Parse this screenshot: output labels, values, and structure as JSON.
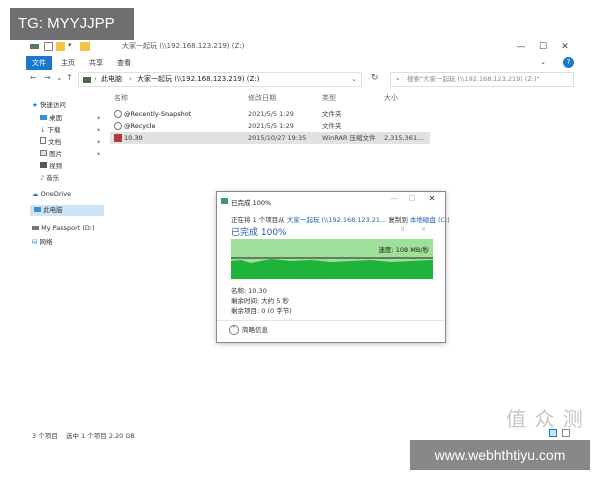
{
  "watermarks": {
    "top": "TG: MYYJJPP",
    "bottom": "www.webhthtiyu.com",
    "logo": "值 众 测"
  },
  "window": {
    "title": "大家一起玩 (\\\\192.168.123.219) (Z:)",
    "controls": {
      "minimize": "—",
      "maximize": "☐",
      "close": "✕"
    },
    "accent_color": "#1979ca"
  },
  "ribbon": {
    "tabs": [
      "文件",
      "主页",
      "共享",
      "查看"
    ],
    "active_tab": "文件"
  },
  "address": {
    "back": "←",
    "forward": "→",
    "recent": "⌄",
    "up": "↑",
    "root": "此电脑",
    "current": "大家一起玩 (\\\\192.168.123.219) (Z:)",
    "refresh": "↻",
    "search_placeholder": "搜索\"大家一起玩 (\\\\192.168.123.219) (Z:)\""
  },
  "sidebar": {
    "quick_access": "快速访问",
    "items": [
      "桌面",
      "下载",
      "文档",
      "图片",
      "视频",
      "音乐"
    ],
    "onedrive": "OneDrive",
    "this_pc": "此电脑",
    "passport": "My Passport (D:)",
    "network": "网络"
  },
  "filelist": {
    "columns": [
      "名称",
      "修改日期",
      "类型",
      "大小"
    ],
    "rows": [
      {
        "name": "@Recently-Snapshot",
        "date": "2021/5/5 1:29",
        "type": "文件夹",
        "size": ""
      },
      {
        "name": "@Recycle",
        "date": "2021/5/5 1:29",
        "type": "文件夹",
        "size": ""
      },
      {
        "name": "10.30",
        "date": "2015/10/27 19:35",
        "type": "WinRAR 压缩文件",
        "size": "2,315,361..."
      }
    ]
  },
  "statusbar": {
    "count": "3 个项目",
    "selection": "选中 1 个项目  2.20 GB"
  },
  "dialog": {
    "title": "已完成 100%",
    "line_prefix": "正在将 1 个项目从",
    "source": "大家一起玩 (\\\\192.168.123.21...",
    "line_mid": "复制到",
    "dest": "本地磁盘 (C:)",
    "heading": "已完成 100%",
    "pause": "II",
    "cancel": "✕",
    "speed": "速度: 108 MB/秒",
    "progress_percent": 100,
    "name_line": "名称: 10.30",
    "remaining_time": "剩余时间: 大约 5 秒",
    "remaining_items": "剩余项目: 0 (0 字节)",
    "details": "简略信息",
    "progress_color": "#06b025"
  }
}
